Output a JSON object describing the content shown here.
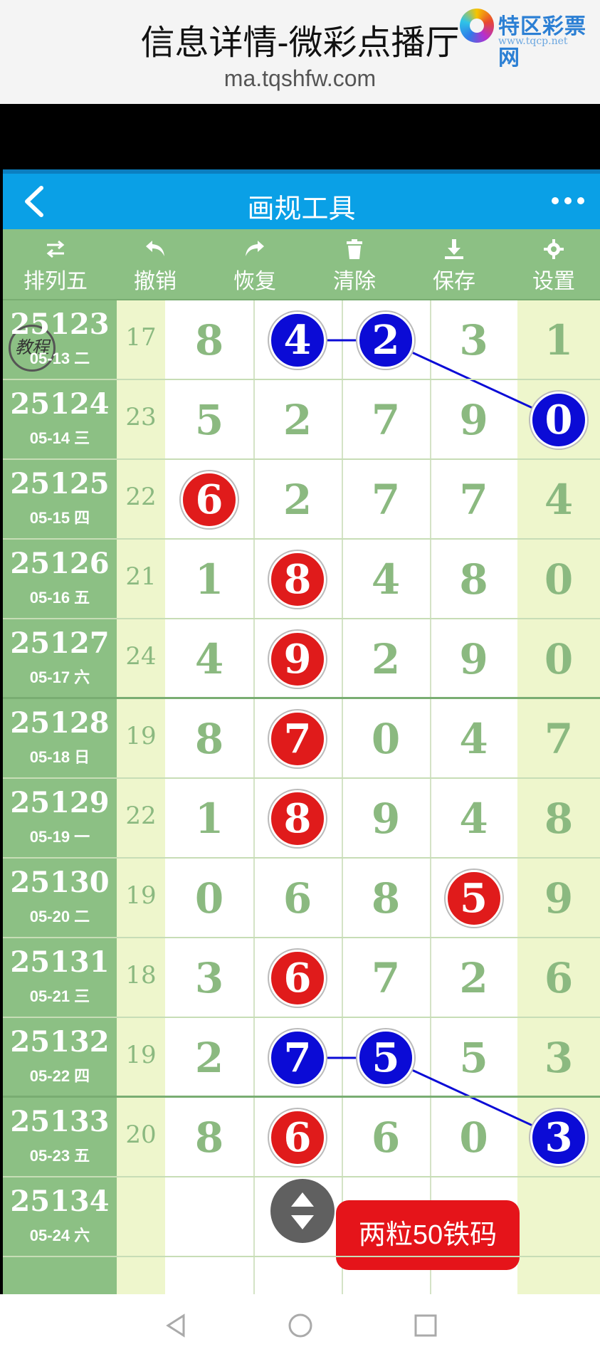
{
  "caption": {
    "title": "信息详情-微彩点播厅",
    "url": "ma.tqshfw.com"
  },
  "logo": {
    "name": "特区彩票网",
    "site": "www.tqcp.net"
  },
  "navbar": {
    "title": "画规工具",
    "back_icon": "chevron-left-icon",
    "more_icon": "more-dots-icon"
  },
  "toolbar": [
    {
      "label": "排列五",
      "icon": "swap-icon"
    },
    {
      "label": "撤销",
      "icon": "undo-icon"
    },
    {
      "label": "恢复",
      "icon": "redo-icon"
    },
    {
      "label": "清除",
      "icon": "trash-icon"
    },
    {
      "label": "保存",
      "icon": "download-icon"
    },
    {
      "label": "设置",
      "icon": "gear-icon"
    }
  ],
  "tutorial": "教程",
  "rows": [
    {
      "period": "25123",
      "date": "05-13 二",
      "sum": "17",
      "digits": [
        "8",
        "4",
        "2",
        "3",
        "1"
      ]
    },
    {
      "period": "25124",
      "date": "05-14 三",
      "sum": "23",
      "digits": [
        "5",
        "2",
        "7",
        "9",
        "0"
      ]
    },
    {
      "period": "25125",
      "date": "05-15 四",
      "sum": "22",
      "digits": [
        "6",
        "2",
        "7",
        "7",
        "4"
      ]
    },
    {
      "period": "25126",
      "date": "05-16 五",
      "sum": "21",
      "digits": [
        "1",
        "8",
        "4",
        "8",
        "0"
      ]
    },
    {
      "period": "25127",
      "date": "05-17 六",
      "sum": "24",
      "digits": [
        "4",
        "9",
        "2",
        "9",
        "0"
      ]
    },
    {
      "period": "25128",
      "date": "05-18 日",
      "sum": "19",
      "digits": [
        "8",
        "7",
        "0",
        "4",
        "7"
      ]
    },
    {
      "period": "25129",
      "date": "05-19 一",
      "sum": "22",
      "digits": [
        "1",
        "8",
        "9",
        "4",
        "8"
      ]
    },
    {
      "period": "25130",
      "date": "05-20 二",
      "sum": "19",
      "digits": [
        "0",
        "6",
        "8",
        "5",
        "9"
      ]
    },
    {
      "period": "25131",
      "date": "05-21 三",
      "sum": "18",
      "digits": [
        "3",
        "6",
        "7",
        "2",
        "6"
      ]
    },
    {
      "period": "25132",
      "date": "05-22 四",
      "sum": "19",
      "digits": [
        "2",
        "7",
        "5",
        "5",
        "3"
      ]
    },
    {
      "period": "25133",
      "date": "05-23 五",
      "sum": "20",
      "digits": [
        "8",
        "6",
        "6",
        "0",
        "3"
      ]
    },
    {
      "period": "25134",
      "date": "05-24 六",
      "sum": "",
      "digits": [
        "",
        "",
        "",
        "",
        ""
      ]
    }
  ],
  "marks": [
    {
      "row": 0,
      "col": 1,
      "color": "blue"
    },
    {
      "row": 0,
      "col": 2,
      "color": "blue"
    },
    {
      "row": 1,
      "col": 4,
      "color": "blue"
    },
    {
      "row": 2,
      "col": 0,
      "color": "red"
    },
    {
      "row": 3,
      "col": 1,
      "color": "red"
    },
    {
      "row": 4,
      "col": 1,
      "color": "red"
    },
    {
      "row": 5,
      "col": 1,
      "color": "red"
    },
    {
      "row": 6,
      "col": 1,
      "color": "red"
    },
    {
      "row": 7,
      "col": 3,
      "color": "red"
    },
    {
      "row": 8,
      "col": 1,
      "color": "red"
    },
    {
      "row": 9,
      "col": 1,
      "color": "blue"
    },
    {
      "row": 9,
      "col": 2,
      "color": "blue"
    },
    {
      "row": 10,
      "col": 4,
      "color": "blue"
    },
    {
      "row": 10,
      "col": 1,
      "color": "red"
    }
  ],
  "links": [
    [
      [
        0,
        1
      ],
      [
        0,
        2
      ],
      [
        1,
        4
      ]
    ],
    [
      [
        9,
        1
      ],
      [
        9,
        2
      ],
      [
        10,
        4
      ]
    ]
  ],
  "promo": "两粒50铁码",
  "colors": {
    "accent": "#0aa0e6",
    "period_bg": "#8cc084",
    "red_ball": "#e01b1b",
    "blue_ball": "#0b0bd6"
  }
}
